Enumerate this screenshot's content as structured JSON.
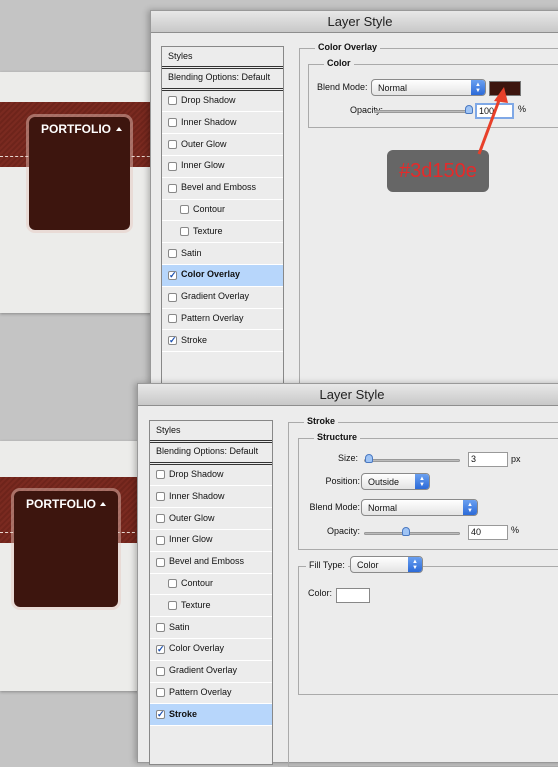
{
  "colors": {
    "overlay": "#3d150e",
    "annotation_text": "#e52a2a",
    "highlight": "#b7d6fb"
  },
  "preview": {
    "tab_label": "PORTFOLIO",
    "tab_icon": "triangle-up-icon"
  },
  "dialog1": {
    "title": "Layer Style",
    "styles": [
      {
        "label": "Styles",
        "type": "head"
      },
      {
        "label": "Blending Options: Default",
        "type": "head"
      },
      {
        "label": "Drop Shadow",
        "checked": false
      },
      {
        "label": "Inner Shadow",
        "checked": false
      },
      {
        "label": "Outer Glow",
        "checked": false
      },
      {
        "label": "Inner Glow",
        "checked": false
      },
      {
        "label": "Bevel and Emboss",
        "checked": false
      },
      {
        "label": "Contour",
        "checked": false,
        "sub": true
      },
      {
        "label": "Texture",
        "checked": false,
        "sub": true
      },
      {
        "label": "Satin",
        "checked": false
      },
      {
        "label": "Color Overlay",
        "checked": true,
        "selected": true
      },
      {
        "label": "Gradient Overlay",
        "checked": false
      },
      {
        "label": "Pattern Overlay",
        "checked": false
      },
      {
        "label": "Stroke",
        "checked": true
      }
    ],
    "section": "Color Overlay",
    "subsection": "Color",
    "blend_mode_label": "Blend Mode:",
    "blend_mode": "Normal",
    "opacity_label": "Opacity:",
    "opacity": "100",
    "opacity_unit": "%",
    "opacity_fraction": 1.0,
    "annotation": "#3d150e"
  },
  "dialog2": {
    "title": "Layer Style",
    "styles": [
      {
        "label": "Styles",
        "type": "head"
      },
      {
        "label": "Blending Options: Default",
        "type": "head"
      },
      {
        "label": "Drop Shadow",
        "checked": false
      },
      {
        "label": "Inner Shadow",
        "checked": false
      },
      {
        "label": "Outer Glow",
        "checked": false
      },
      {
        "label": "Inner Glow",
        "checked": false
      },
      {
        "label": "Bevel and Emboss",
        "checked": false
      },
      {
        "label": "Contour",
        "checked": false,
        "sub": true
      },
      {
        "label": "Texture",
        "checked": false,
        "sub": true
      },
      {
        "label": "Satin",
        "checked": false
      },
      {
        "label": "Color Overlay",
        "checked": true
      },
      {
        "label": "Gradient Overlay",
        "checked": false
      },
      {
        "label": "Pattern Overlay",
        "checked": false
      },
      {
        "label": "Stroke",
        "checked": true,
        "selected": true
      }
    ],
    "section": "Stroke",
    "subsection": "Structure",
    "size_label": "Size:",
    "size": "3",
    "size_unit": "px",
    "position_label": "Position:",
    "position": "Outside",
    "blend_mode_label": "Blend Mode:",
    "blend_mode": "Normal",
    "opacity_label": "Opacity:",
    "opacity": "40",
    "opacity_unit": "%",
    "fill_type_label": "Fill Type:",
    "fill_type": "Color",
    "color_label": "Color:",
    "stroke_color": "#ffffff"
  }
}
